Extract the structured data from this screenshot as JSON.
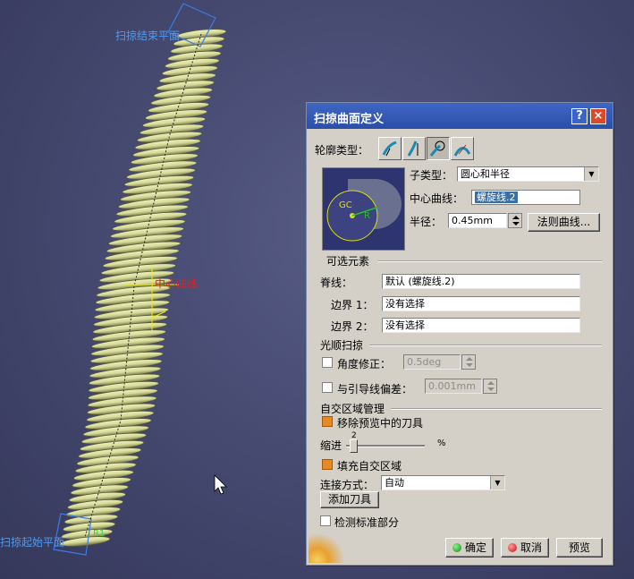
{
  "viewport": {
    "label_sweep_end": "扫掠结束平面",
    "label_center_curve": "中心曲线",
    "label_sweep_start": "扫掠起始平面",
    "label_small": "R1"
  },
  "dialog": {
    "title": "扫掠曲面定义",
    "help_label": "?",
    "close_label": "×",
    "profile_type_label": "轮廓类型：",
    "profile_type_icons": [
      "explicit-profile-icon",
      "line-profile-icon",
      "circle-profile-icon",
      "conic-profile-icon"
    ],
    "preview_labels": {
      "gc": "GC",
      "r": "R"
    },
    "subtype_label": "子类型：",
    "subtype_value": "圆心和半径",
    "center_curve_label": "中心曲线：",
    "center_curve_value": "螺旋线.2",
    "radius_label": "半径：",
    "radius_value": "0.45mm",
    "law_curve_button": "法则曲线...",
    "optional_group": "可选元素",
    "spine_label": "脊线：",
    "spine_value": "默认 (螺旋线.2)",
    "boundary1_label": "边界 1：",
    "boundary1_value": "没有选择",
    "boundary2_label": "边界 2：",
    "boundary2_value": "没有选择",
    "smooth_group": "光顺扫掠",
    "angle_correction_label": "角度修正：",
    "angle_correction_value": "0.5deg",
    "angle_correction_checked": false,
    "deviation_label": "与引导线偏差：",
    "deviation_value": "0.001mm",
    "deviation_checked": false,
    "self_intersection_group": "自交区域管理",
    "remove_tools_label": "移除预览中的刀具",
    "remove_tools_checked": true,
    "step_label": "缩进",
    "step_value": "2",
    "step_unit": "%",
    "fill_label": "填充自交区域",
    "fill_checked": true,
    "connection_label": "连接方式：",
    "connection_value": "自动",
    "add_tool_button": "添加刀具",
    "canonical_label": "检测标准部分",
    "canonical_checked": false,
    "ok_button": "确定",
    "cancel_button": "取消",
    "preview_button": "预览"
  },
  "colors": {
    "titlebar": "#2a4fa8",
    "dialog_bg": "#d4d0c8",
    "selection": "#3a6ea5",
    "spring": "#d8dc9c",
    "checked": "#e88a22"
  }
}
